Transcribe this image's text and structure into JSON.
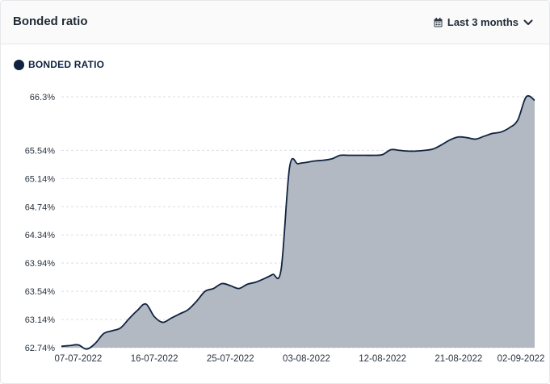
{
  "header": {
    "title": "Bonded ratio",
    "range_label": "Last 3 months",
    "range_icon": "calendar-icon",
    "dropdown_icon": "chevron-down-icon"
  },
  "chart_data": {
    "type": "area",
    "series": [
      {
        "name": "BONDED RATIO",
        "color": "#0f2340",
        "fill": "#b2b9c3",
        "points": [
          [
            "2022-07-05",
            62.76
          ],
          [
            "2022-07-06",
            62.77
          ],
          [
            "2022-07-07",
            62.78
          ],
          [
            "2022-07-08",
            62.72
          ],
          [
            "2022-07-09",
            62.8
          ],
          [
            "2022-07-10",
            62.94
          ],
          [
            "2022-07-11",
            62.98
          ],
          [
            "2022-07-12",
            63.02
          ],
          [
            "2022-07-13",
            63.15
          ],
          [
            "2022-07-14",
            63.27
          ],
          [
            "2022-07-15",
            63.36
          ],
          [
            "2022-07-16",
            63.18
          ],
          [
            "2022-07-17",
            63.1
          ],
          [
            "2022-07-18",
            63.16
          ],
          [
            "2022-07-19",
            63.22
          ],
          [
            "2022-07-20",
            63.28
          ],
          [
            "2022-07-21",
            63.4
          ],
          [
            "2022-07-22",
            63.54
          ],
          [
            "2022-07-23",
            63.58
          ],
          [
            "2022-07-24",
            63.65
          ],
          [
            "2022-07-25",
            63.62
          ],
          [
            "2022-07-26",
            63.58
          ],
          [
            "2022-07-27",
            63.64
          ],
          [
            "2022-07-28",
            63.67
          ],
          [
            "2022-07-29",
            63.72
          ],
          [
            "2022-07-30",
            63.78
          ],
          [
            "2022-07-31",
            63.85
          ],
          [
            "2022-08-01",
            65.3
          ],
          [
            "2022-08-02",
            65.35
          ],
          [
            "2022-08-03",
            65.37
          ],
          [
            "2022-08-04",
            65.39
          ],
          [
            "2022-08-05",
            65.4
          ],
          [
            "2022-08-06",
            65.42
          ],
          [
            "2022-08-07",
            65.47
          ],
          [
            "2022-08-08",
            65.47
          ],
          [
            "2022-08-09",
            65.47
          ],
          [
            "2022-08-10",
            65.47
          ],
          [
            "2022-08-11",
            65.47
          ],
          [
            "2022-08-12",
            65.48
          ],
          [
            "2022-08-13",
            65.55
          ],
          [
            "2022-08-14",
            65.54
          ],
          [
            "2022-08-15",
            65.53
          ],
          [
            "2022-08-16",
            65.53
          ],
          [
            "2022-08-17",
            65.54
          ],
          [
            "2022-08-18",
            65.56
          ],
          [
            "2022-08-19",
            65.62
          ],
          [
            "2022-08-20",
            65.69
          ],
          [
            "2022-08-21",
            65.73
          ],
          [
            "2022-08-22",
            65.72
          ],
          [
            "2022-08-23",
            65.7
          ],
          [
            "2022-08-24",
            65.74
          ],
          [
            "2022-08-25",
            65.78
          ],
          [
            "2022-08-26",
            65.8
          ],
          [
            "2022-08-27",
            65.86
          ],
          [
            "2022-08-28",
            65.97
          ],
          [
            "2022-08-29",
            66.3
          ],
          [
            "2022-08-30",
            66.25
          ]
        ]
      }
    ],
    "xlabel": "",
    "ylabel": "",
    "x_ticks": [
      "07-07-2022",
      "16-07-2022",
      "25-07-2022",
      "03-08-2022",
      "12-08-2022",
      "21-08-2022",
      "02-09-2022"
    ],
    "y_ticks": [
      "62.74%",
      "63.14%",
      "63.54%",
      "63.94%",
      "64.34%",
      "64.74%",
      "65.14%",
      "65.54%",
      "66.3%"
    ],
    "ylim": [
      62.74,
      66.3
    ],
    "grid": "horizontal dashed",
    "legend_position": "top-left"
  }
}
